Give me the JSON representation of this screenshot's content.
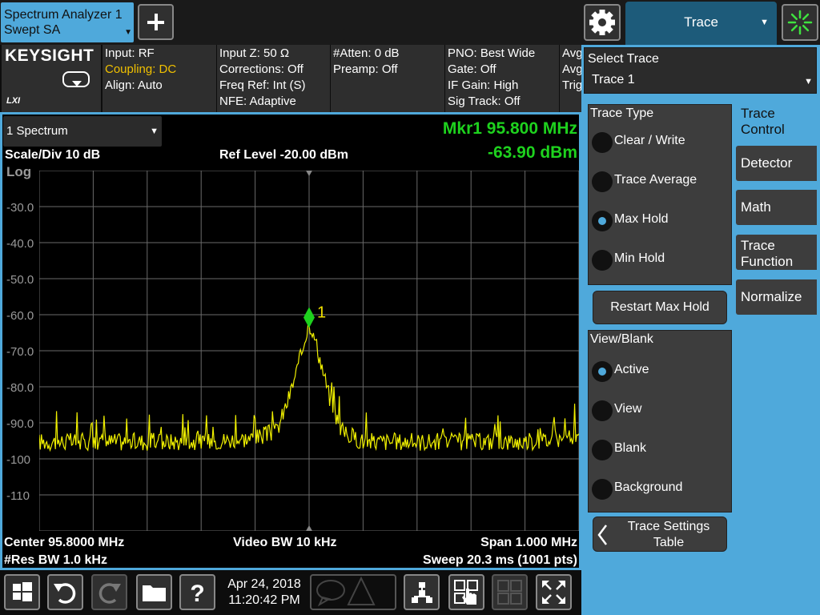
{
  "topbar": {
    "screen_tab_line1": "Spectrum Analyzer 1",
    "screen_tab_line2": "Swept SA",
    "menu_title": "Trace"
  },
  "infobar": {
    "logo": "KEYSIGHT",
    "lxi": "LXI",
    "col1": [
      "Input: RF",
      "Coupling: DC",
      "Align: Auto"
    ],
    "col2": [
      "Input Z: 50 Ω",
      "Corrections: Off",
      "Freq Ref: Int (S)",
      "NFE: Adaptive"
    ],
    "col3": [
      "#Atten: 0 dB",
      "Preamp: Off"
    ],
    "col4": [
      "PNO: Best Wide",
      "Gate: Off",
      "IF Gain: High",
      "Sig Track: Off"
    ],
    "col5": [
      "Avg",
      "Avg",
      "Trig"
    ]
  },
  "screen": {
    "window_select": "1 Spectrum",
    "marker_freq": "Mkr1  95.800 MHz",
    "marker_amp": "-63.90 dBm",
    "scale_div": "Scale/Div 10 dB",
    "ref_level": "Ref Level -20.00 dBm",
    "log_label": "Log",
    "marker_label": "1",
    "center": "Center 95.8000 MHz",
    "video_bw": "Video BW 10 kHz",
    "span": "Span 1.000 MHz",
    "res_bw": "#Res BW 1.0 kHz",
    "sweep": "Sweep 20.3 ms (1001 pts)"
  },
  "chart_data": {
    "type": "line",
    "xlabel": "",
    "ylabel": "",
    "y_tick_labels": [
      "-30.0",
      "-40.0",
      "-50.0",
      "-60.0",
      "-70.0",
      "-80.0",
      "-90.0",
      "-100",
      "-110"
    ],
    "ylim": [
      -120,
      -20
    ],
    "xlim_mhz": [
      95.3,
      96.3
    ],
    "grid": true,
    "trace_color": "#f0f000",
    "marker": {
      "x_mhz": 95.8,
      "y_dbm": -63.9,
      "color": "#1ed21e"
    },
    "noise_floor_dbm": -95,
    "series": [
      {
        "x_mhz": [
          95.3,
          95.4,
          95.5,
          95.6,
          95.7,
          95.74,
          95.76,
          95.78,
          95.79,
          95.8,
          95.81,
          95.82,
          95.84,
          95.86,
          95.9,
          96.0,
          96.1,
          96.2,
          96.3
        ],
        "y_dbm": [
          -95,
          -95,
          -95,
          -95,
          -94,
          -92,
          -84,
          -74,
          -68,
          -63.9,
          -66,
          -72,
          -84,
          -92,
          -95,
          -95,
          -95,
          -95,
          -94
        ]
      }
    ]
  },
  "panel": {
    "select_trace_title": "Select Trace",
    "select_trace_value": "Trace 1",
    "trace_type_title": "Trace Type",
    "trace_types": [
      "Clear / Write",
      "Trace Average",
      "Max Hold",
      "Min Hold"
    ],
    "trace_type_selected": "Max Hold",
    "restart_label": "Restart Max Hold",
    "view_blank_title": "View/Blank",
    "view_blank": [
      "Active",
      "View",
      "Blank",
      "Background"
    ],
    "view_blank_selected": "Active",
    "trace_table_line1": "Trace Settings",
    "trace_table_line2": "Table",
    "tabs": [
      {
        "line1": "Trace",
        "line2": "Control"
      },
      {
        "line1": "Detector",
        "line2": ""
      },
      {
        "line1": "Math",
        "line2": ""
      },
      {
        "line1": "Trace",
        "line2": "Function"
      },
      {
        "line1": "Normalize",
        "line2": ""
      }
    ]
  },
  "bottombar": {
    "date": "Apr 24, 2018",
    "time": "11:20:42 PM"
  },
  "colors": {
    "accent": "#4fa9db",
    "marker_text": "#1ed21e",
    "trace": "#f0f000",
    "warn": "#f0c000"
  }
}
